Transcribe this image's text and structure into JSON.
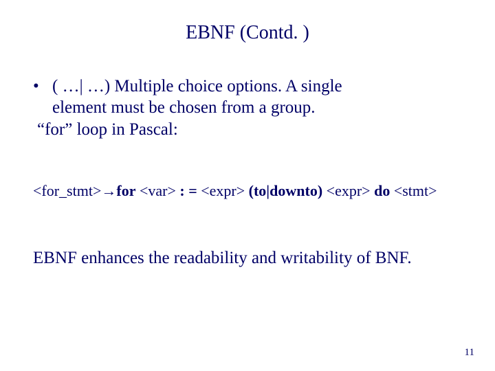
{
  "title": "EBNF  (Contd. )",
  "bullet": {
    "sym": "•",
    "text_line1": "( …| …)   Multiple choice options.  A single",
    "text_line2": "element must be chosen from a group.",
    "pascal_line": "“for” loop in Pascal:"
  },
  "code": {
    "p1": "<for_stmt>",
    "arrow": "→",
    "for_kw": "for",
    "p2": " <var> ",
    "assign": ": =",
    "p3": " <expr> ",
    "todown": "(to|downto)",
    "p4": " <expr> ",
    "do_kw": "do",
    "p5": " <stmt>"
  },
  "ending": "EBNF  enhances the readability and writability of BNF.",
  "page_number": "11"
}
